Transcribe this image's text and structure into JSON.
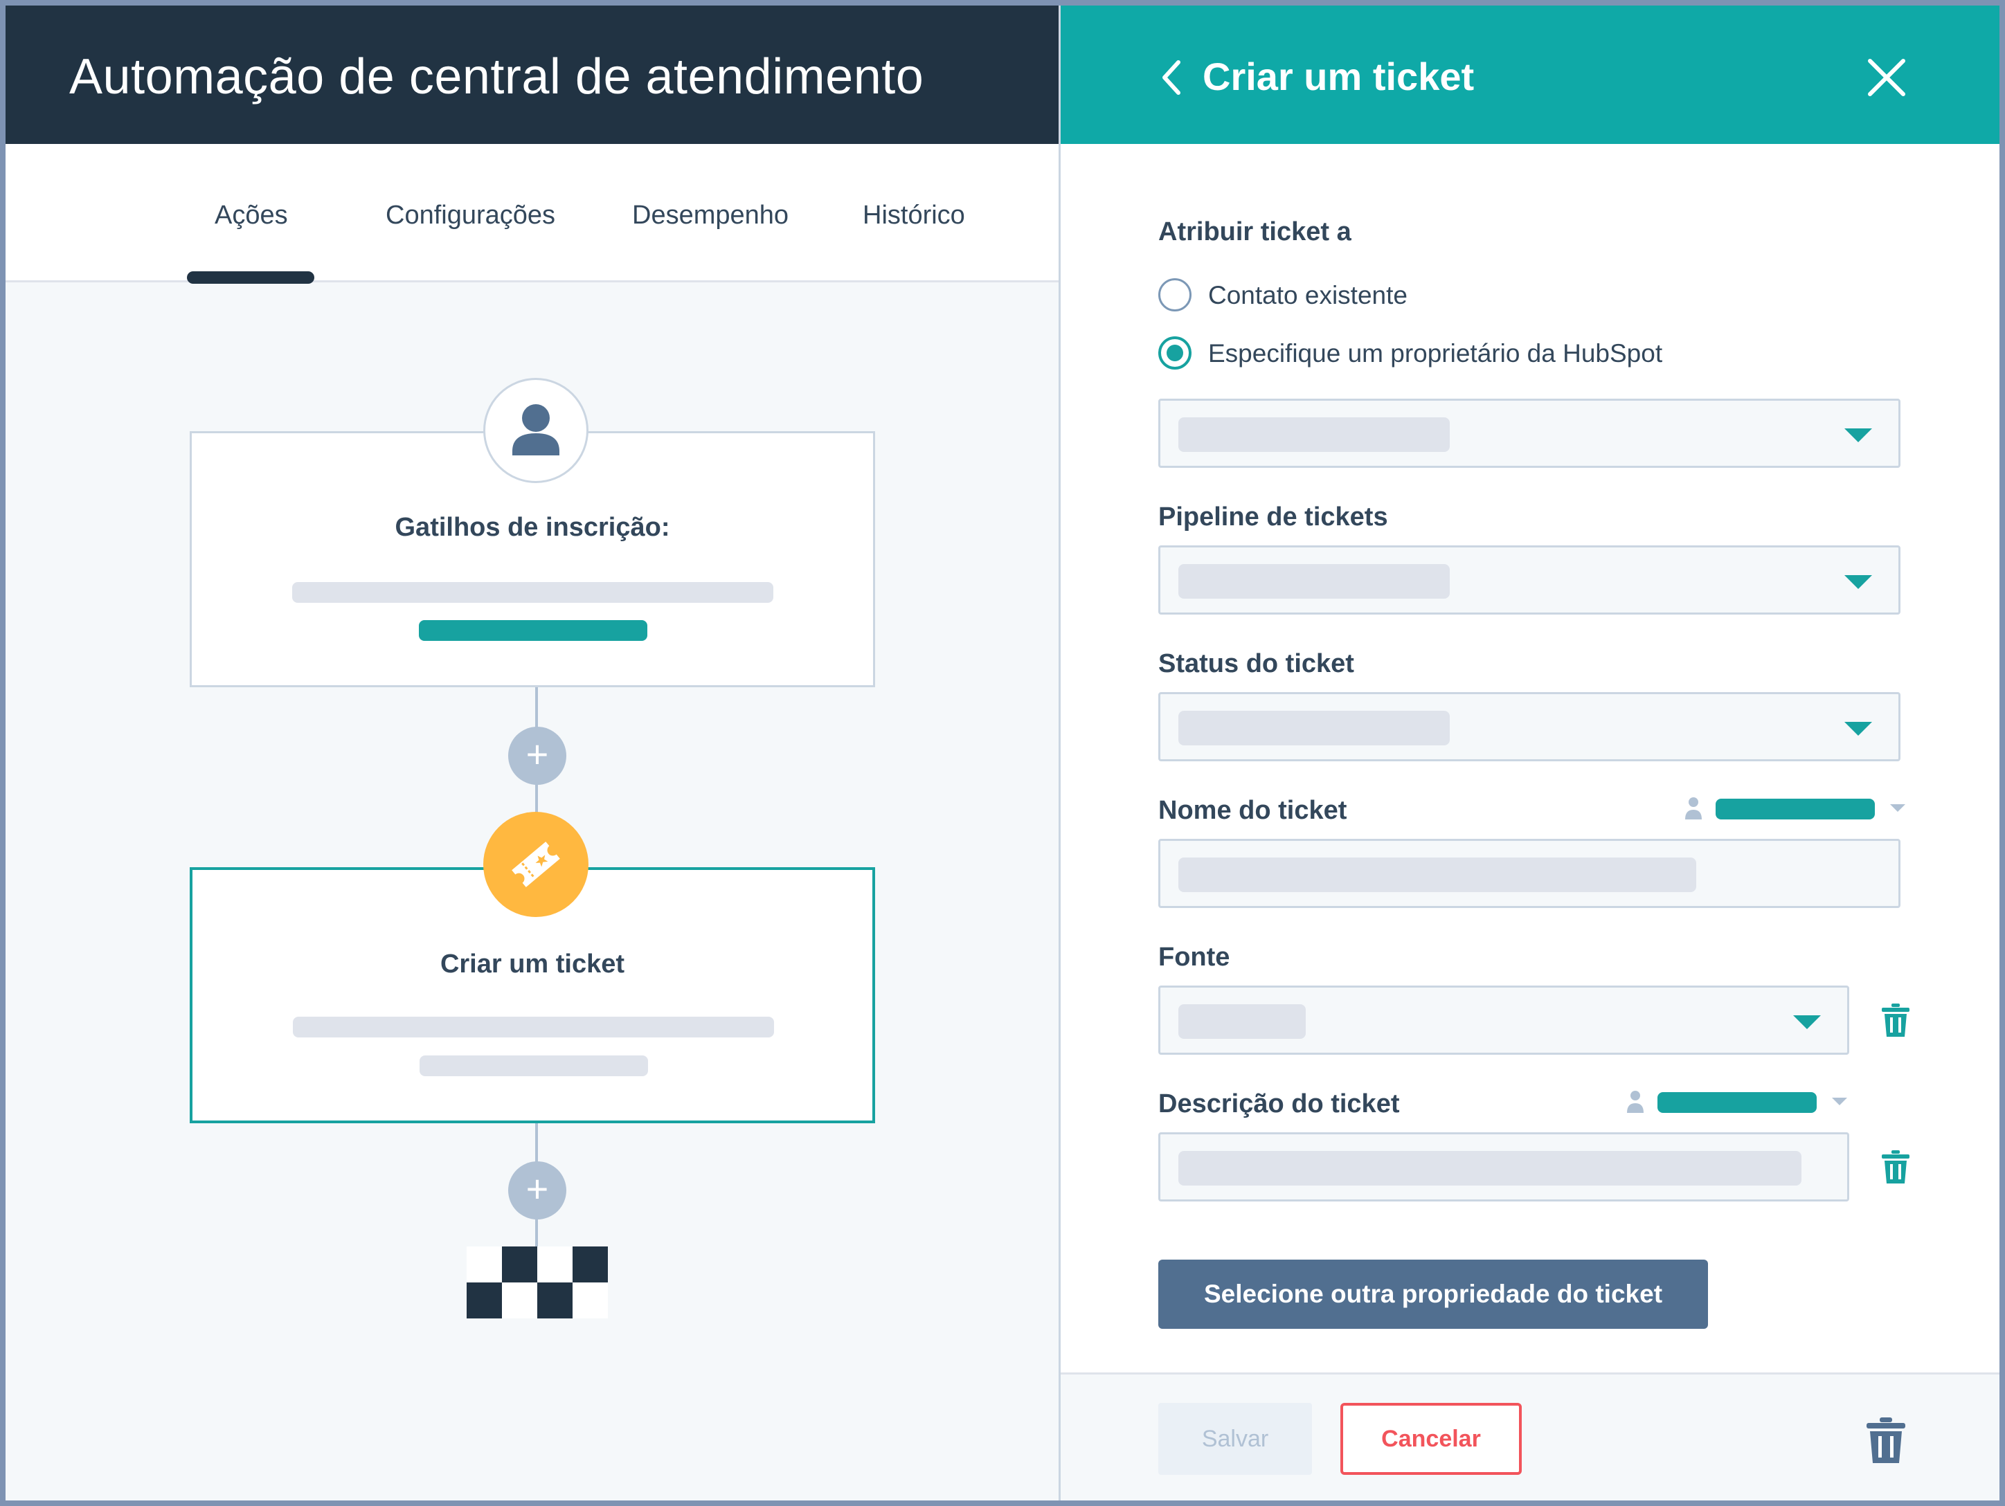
{
  "workflow": {
    "title": "Automação de central de atendimento",
    "tabs": [
      {
        "label": "Ações",
        "active": true
      },
      {
        "label": "Configurações",
        "active": false
      },
      {
        "label": "Desempenho",
        "active": false
      },
      {
        "label": "Histórico",
        "active": false
      }
    ],
    "trigger_card": {
      "title": "Gatilhos de inscrição:",
      "icon": "person-icon"
    },
    "action_card": {
      "title": "Criar um ticket",
      "icon": "ticket-icon"
    }
  },
  "panel": {
    "title": "Criar um ticket",
    "assign_label": "Atribuir ticket a",
    "radio_options": [
      {
        "label": "Contato existente",
        "checked": false
      },
      {
        "label": "Especifique um proprietário da HubSpot",
        "checked": true
      }
    ],
    "fields": {
      "pipeline_label": "Pipeline de tickets",
      "status_label": "Status do ticket",
      "name_label": "Nome do ticket",
      "source_label": "Fonte",
      "description_label": "Descrição do ticket"
    },
    "select_property_button": "Selecione outra propriedade do ticket",
    "save_button": "Salvar",
    "cancel_button": "Cancelar"
  },
  "colors": {
    "header_dark": "#213343",
    "teal": "#17a2a0",
    "panel_header": "#0fa9a7",
    "ticket_orange": "#ffb840",
    "cancel_red": "#f2545b",
    "button_slate": "#516f90"
  }
}
